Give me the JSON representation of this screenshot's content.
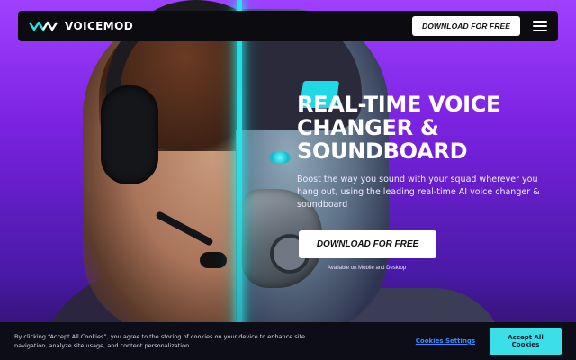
{
  "brand": {
    "name": "VOICEMOD",
    "logo_icon": "voicemod-logo-icon"
  },
  "navbar": {
    "download_label": "DOWNLOAD FOR FREE",
    "menu_icon": "hamburger-menu-icon"
  },
  "hero": {
    "title": "REAL-TIME VOICE CHANGER & SOUNDBOARD",
    "subtitle": "Boost the way you sound with your squad wherever you hang out, using the leading real-time AI voice changer & soundboard",
    "cta_label": "DOWNLOAD FOR FREE",
    "availability": "Available on Mobile and Desktop"
  },
  "cookie_banner": {
    "text": "By clicking “Accept All Cookies”, you agree to the storing of cookies on your device to enhance site navigation, analyze site usage, and content personalization.",
    "settings_label": "Cookies Settings",
    "accept_label": "Accept All Cookies"
  },
  "colors": {
    "accent": "#28e3e6",
    "background_top": "#a040ff",
    "background_bottom": "#2a1060",
    "navbar": "#0b0b10",
    "cookie_bar": "#0c0d17",
    "link": "#3c8cff"
  }
}
